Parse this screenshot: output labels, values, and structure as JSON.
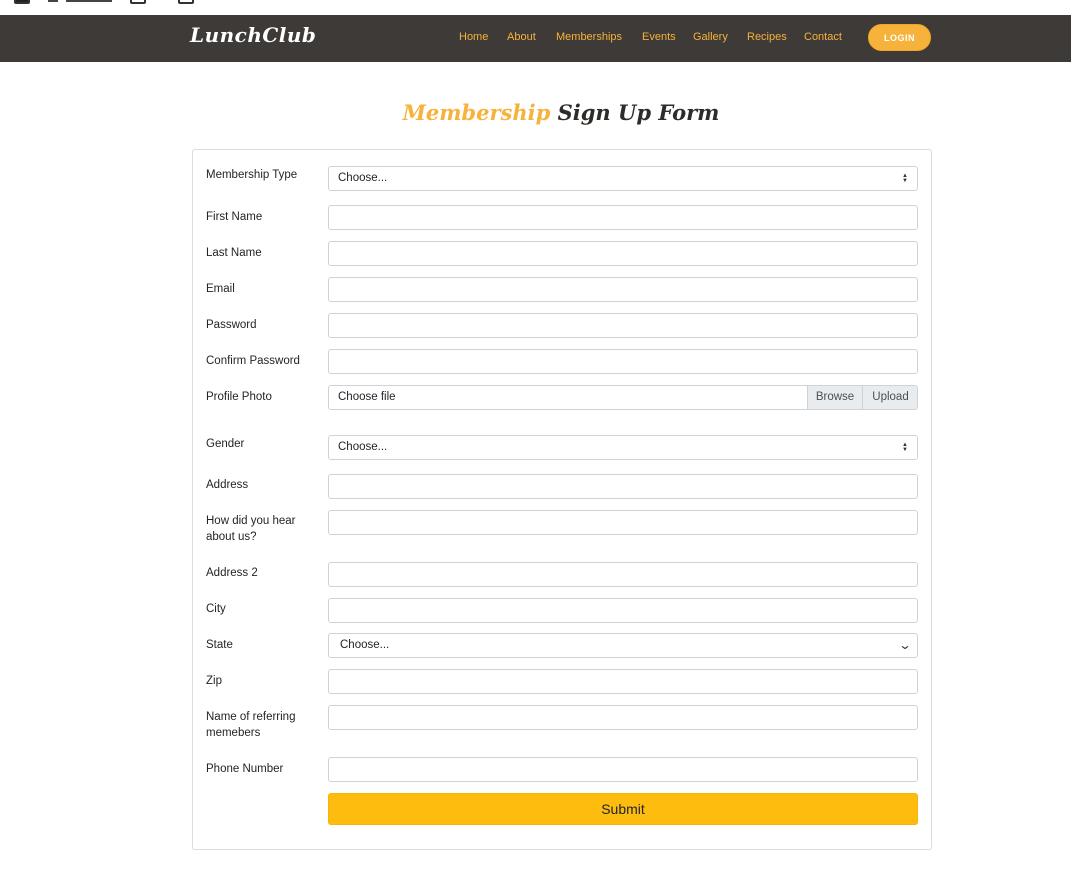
{
  "nav": {
    "brand": "LunchClub",
    "links": [
      "Home",
      "About",
      "Memberships",
      "Events",
      "Gallery",
      "Recipes",
      "Contact"
    ],
    "login_label": "LOGIN"
  },
  "page": {
    "title_accent": "Membership",
    "title_rest": "Sign Up Form"
  },
  "form": {
    "membership_type": {
      "label": "Membership Type",
      "value": "Choose..."
    },
    "first_name": {
      "label": "First Name",
      "value": ""
    },
    "last_name": {
      "label": "Last Name",
      "value": ""
    },
    "email": {
      "label": "Email",
      "value": ""
    },
    "password": {
      "label": "Password",
      "value": ""
    },
    "confirm_password": {
      "label": "Confirm Password",
      "value": ""
    },
    "profile_photo": {
      "label": "Profile Photo",
      "file_label": "Choose file",
      "browse_label": "Browse",
      "upload_label": "Upload"
    },
    "gender": {
      "label": "Gender",
      "value": "Choose..."
    },
    "address": {
      "label": "Address",
      "value": ""
    },
    "heard_about": {
      "label": "How did you hear about us?",
      "value": ""
    },
    "address2": {
      "label": "Address 2",
      "value": ""
    },
    "city": {
      "label": "City",
      "value": ""
    },
    "state": {
      "label": "State",
      "value": "Choose..."
    },
    "zip": {
      "label": "Zip",
      "value": ""
    },
    "referring": {
      "label": "Name of referring memebers",
      "value": ""
    },
    "phone": {
      "label": "Phone Number",
      "value": ""
    },
    "submit_label": "Submit"
  },
  "colors": {
    "navbar_bg": "#3e3a37",
    "accent": "#f6b23a",
    "submit_bg": "#fdbc0e"
  },
  "icons": {
    "select_arrows": "updown-arrows-icon",
    "state_arrow": "chevron-down-icon"
  }
}
